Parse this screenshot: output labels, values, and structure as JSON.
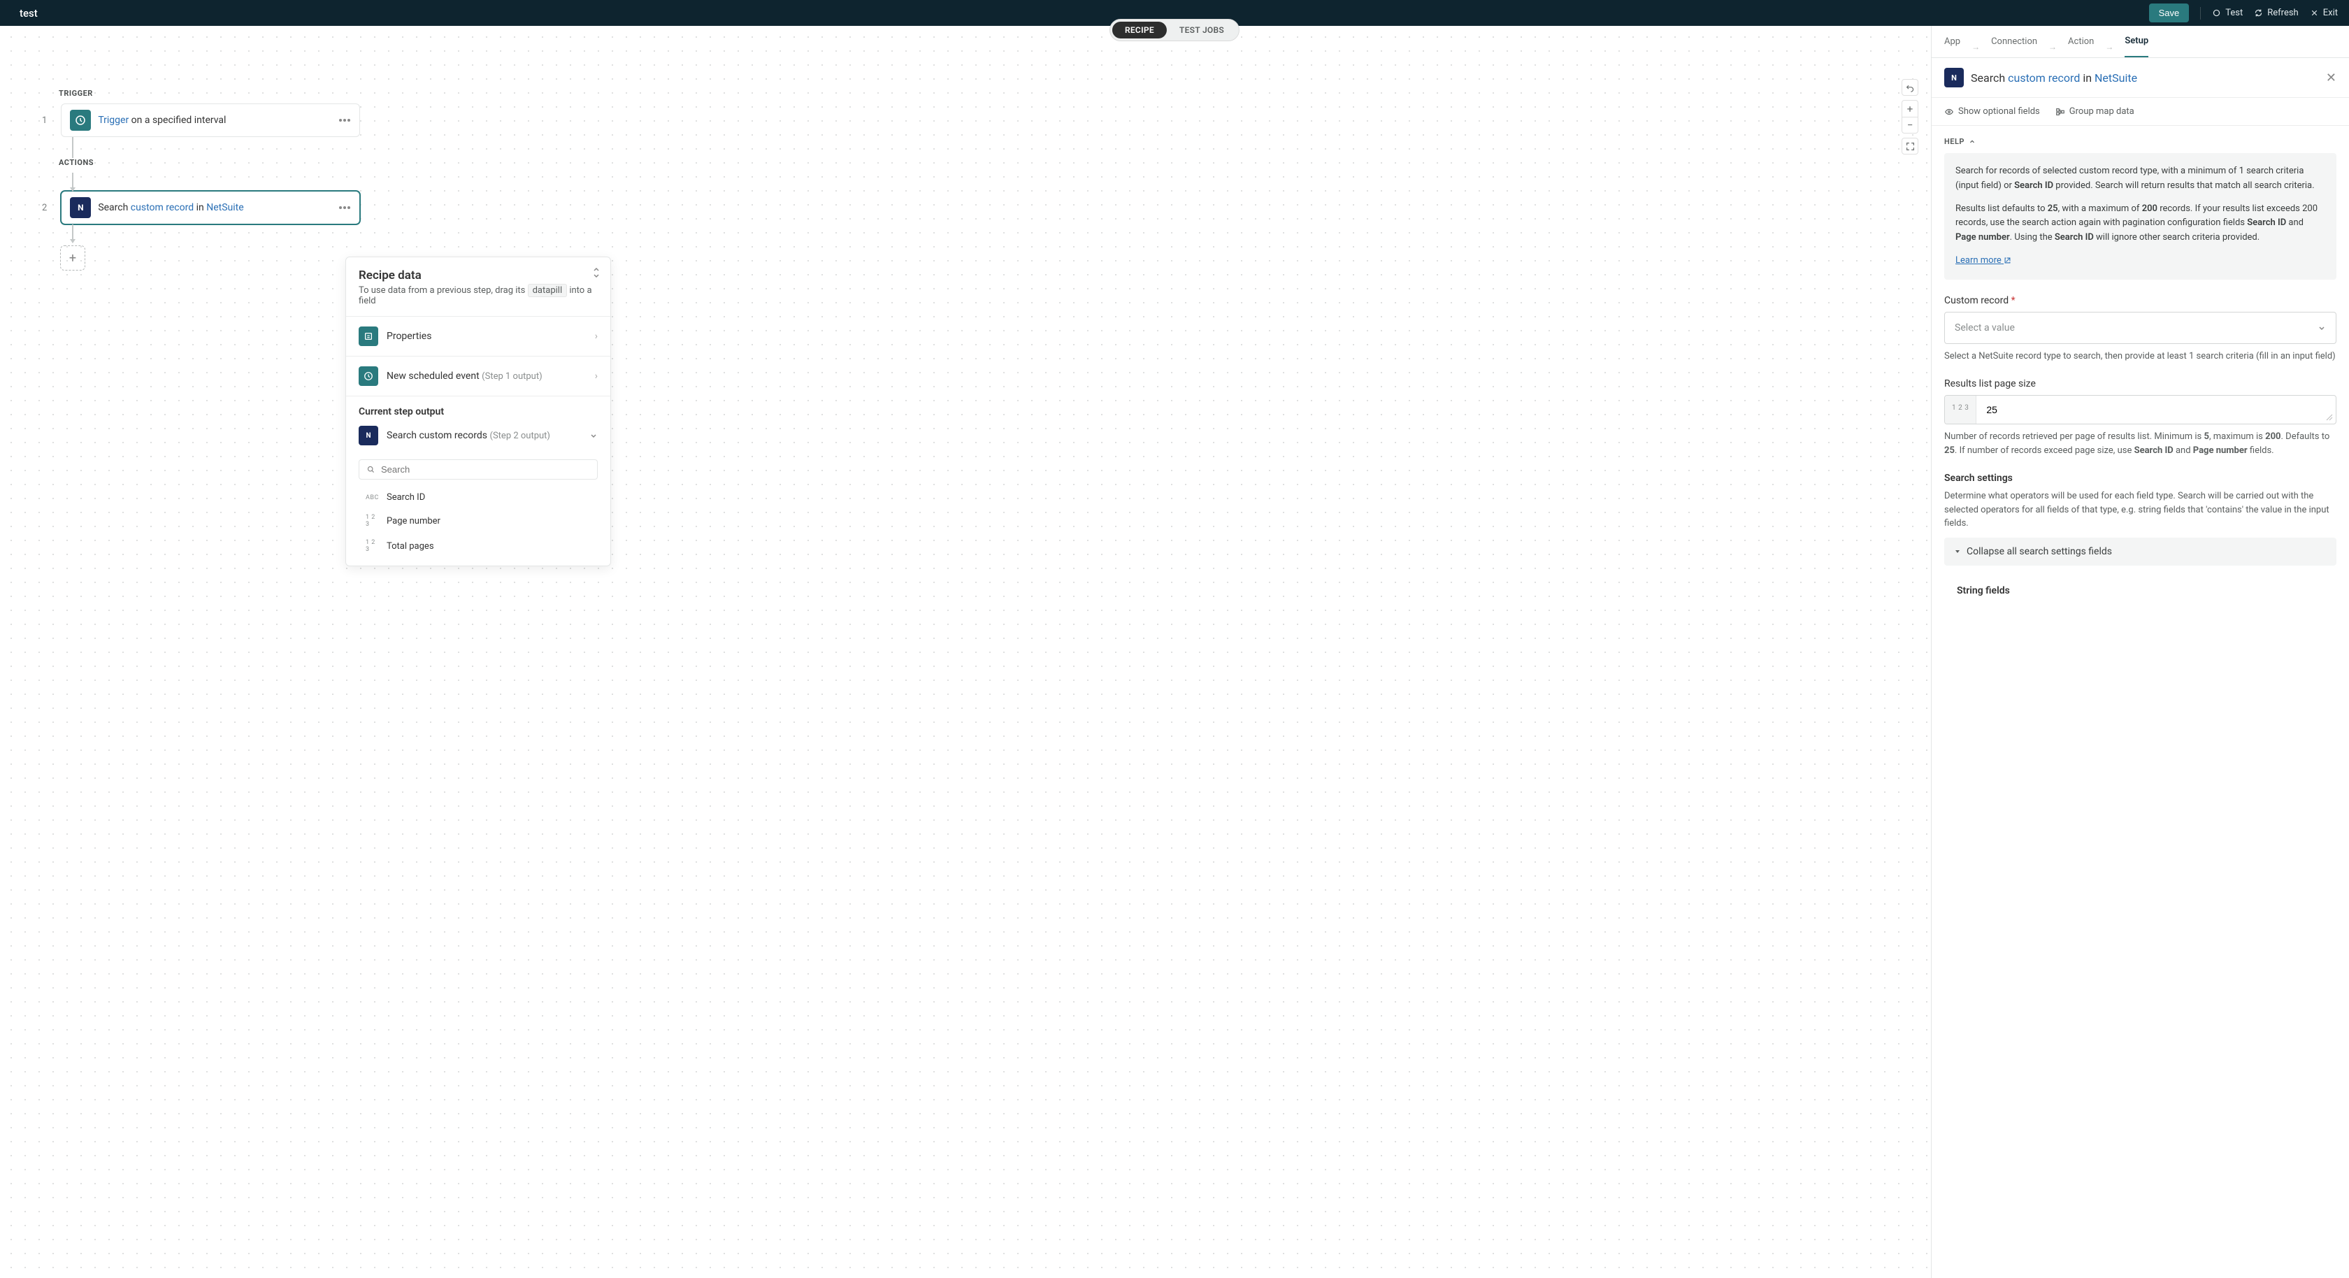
{
  "header": {
    "title": "test",
    "save": "Save",
    "test": "Test",
    "refresh": "Refresh",
    "exit": "Exit"
  },
  "tabSwitcher": {
    "recipe": "RECIPE",
    "testJobs": "TEST JOBS"
  },
  "flow": {
    "triggerLabel": "TRIGGER",
    "step1Num": "1",
    "step1_a": "Trigger",
    "step1_b": " on a specified interval",
    "actionsLabel": "ACTIONS",
    "step2Num": "2",
    "step2_a": "Search ",
    "step2_b": "custom record",
    "step2_c": " in ",
    "step2_d": "NetSuite"
  },
  "recipeData": {
    "title": "Recipe data",
    "sub_a": "To use data from a previous step, drag its ",
    "sub_pill": "datapill",
    "sub_b": " into a field",
    "props": "Properties",
    "newEvent": "New scheduled event",
    "newEventSub": "(Step 1 output)",
    "currentLabel": "Current step output",
    "searchCustom": "Search custom records",
    "searchCustomSub": "(Step 2 output)",
    "searchPlaceholder": "Search",
    "pills": {
      "searchId": "Search ID",
      "pageNumber": "Page number",
      "totalPages": "Total pages"
    },
    "types": {
      "abc": "ABC",
      "num": "1 2 3"
    }
  },
  "panel": {
    "tabs": {
      "app": "App",
      "connection": "Connection",
      "action": "Action",
      "setup": "Setup"
    },
    "title_a": "Search ",
    "title_b": "custom record",
    "title_c": " in ",
    "title_d": "NetSuite",
    "showOptional": "Show optional fields",
    "groupMap": "Group map data",
    "helpLabel": "HELP",
    "help_p1_a": "Search for records of selected custom record type, with a minimum of 1 search criteria (input field) or ",
    "help_p1_b": "Search ID",
    "help_p1_c": " provided. Search will return results that match all search criteria.",
    "help_p2_a": "Results list defaults to ",
    "help_p2_b": "25",
    "help_p2_c": ", with a maximum of ",
    "help_p2_d": "200",
    "help_p2_e": " records. If your results list exceeds 200 records, use the search action again with pagination configuration fields ",
    "help_p2_f": "Search ID",
    "help_p2_g": " and ",
    "help_p2_h": "Page number",
    "help_p2_i": ". Using the ",
    "help_p2_j": "Search ID",
    "help_p2_k": " will ignore other search criteria provided.",
    "learnMore": "Learn more",
    "customRecord": {
      "label": "Custom record",
      "placeholder": "Select a value",
      "help": "Select a NetSuite record type to search, then provide at least 1 search criteria (fill in an input field)"
    },
    "pageSize": {
      "label": "Results list page size",
      "value": "25",
      "prefix": "1 2 3",
      "help_a": "Number of records retrieved per page of results list. Minimum is ",
      "help_b": "5",
      "help_c": ", maximum is ",
      "help_d": "200",
      "help_e": ". Defaults to ",
      "help_f": "25",
      "help_g": ". If number of records exceed page size, use ",
      "help_h": "Search ID",
      "help_i": " and ",
      "help_j": "Page number",
      "help_k": " fields."
    },
    "searchSettings": {
      "label": "Search settings",
      "help": "Determine what operators will be used for each field type. Search will be carried out with the selected operators for all fields of that type, e.g. string fields that 'contains' the value in the input fields.",
      "collapse": "Collapse all search settings fields",
      "stringFields": "String fields"
    }
  }
}
